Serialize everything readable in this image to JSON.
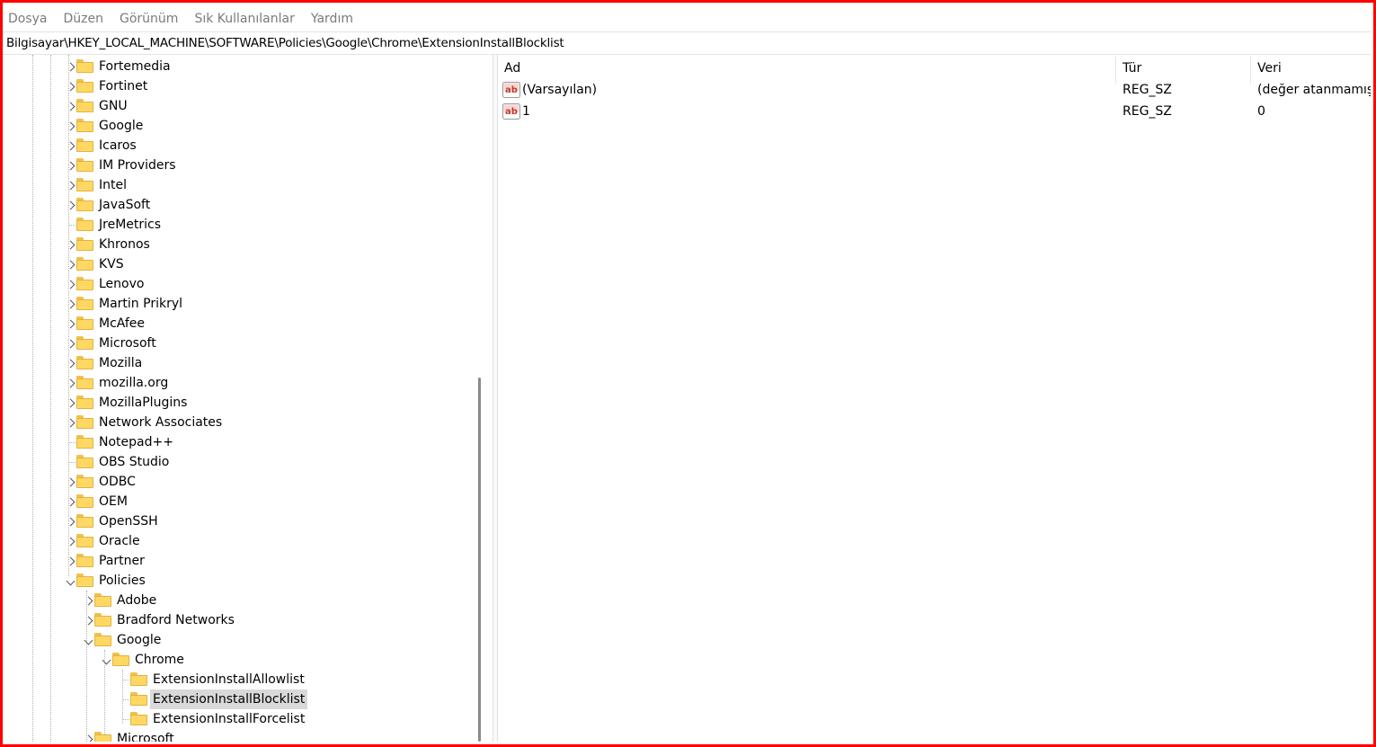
{
  "menu": [
    "Dosya",
    "Düzen",
    "Görünüm",
    "Sık Kullanılanlar",
    "Yardım"
  ],
  "address": "Bilgisayar\\HKEY_LOCAL_MACHINE\\SOFTWARE\\Policies\\Google\\Chrome\\ExtensionInstallBlocklist",
  "tree": [
    {
      "label": "Fortemedia",
      "level": 0,
      "exp": "collapsed"
    },
    {
      "label": "Fortinet",
      "level": 0,
      "exp": "collapsed"
    },
    {
      "label": "GNU",
      "level": 0,
      "exp": "collapsed"
    },
    {
      "label": "Google",
      "level": 0,
      "exp": "collapsed"
    },
    {
      "label": "Icaros",
      "level": 0,
      "exp": "collapsed"
    },
    {
      "label": "IM Providers",
      "level": 0,
      "exp": "collapsed"
    },
    {
      "label": "Intel",
      "level": 0,
      "exp": "collapsed"
    },
    {
      "label": "JavaSoft",
      "level": 0,
      "exp": "collapsed"
    },
    {
      "label": "JreMetrics",
      "level": 0,
      "exp": "none"
    },
    {
      "label": "Khronos",
      "level": 0,
      "exp": "collapsed"
    },
    {
      "label": "KVS",
      "level": 0,
      "exp": "collapsed"
    },
    {
      "label": "Lenovo",
      "level": 0,
      "exp": "collapsed"
    },
    {
      "label": "Martin Prikryl",
      "level": 0,
      "exp": "collapsed"
    },
    {
      "label": "McAfee",
      "level": 0,
      "exp": "collapsed"
    },
    {
      "label": "Microsoft",
      "level": 0,
      "exp": "collapsed"
    },
    {
      "label": "Mozilla",
      "level": 0,
      "exp": "collapsed"
    },
    {
      "label": "mozilla.org",
      "level": 0,
      "exp": "collapsed"
    },
    {
      "label": "MozillaPlugins",
      "level": 0,
      "exp": "collapsed"
    },
    {
      "label": "Network Associates",
      "level": 0,
      "exp": "collapsed"
    },
    {
      "label": "Notepad++",
      "level": 0,
      "exp": "none"
    },
    {
      "label": "OBS Studio",
      "level": 0,
      "exp": "none"
    },
    {
      "label": "ODBC",
      "level": 0,
      "exp": "collapsed"
    },
    {
      "label": "OEM",
      "level": 0,
      "exp": "collapsed"
    },
    {
      "label": "OpenSSH",
      "level": 0,
      "exp": "collapsed"
    },
    {
      "label": "Oracle",
      "level": 0,
      "exp": "collapsed"
    },
    {
      "label": "Partner",
      "level": 0,
      "exp": "collapsed"
    },
    {
      "label": "Policies",
      "level": 0,
      "exp": "expanded"
    },
    {
      "label": "Adobe",
      "level": 1,
      "exp": "collapsed"
    },
    {
      "label": "Bradford Networks",
      "level": 1,
      "exp": "collapsed"
    },
    {
      "label": "Google",
      "level": 1,
      "exp": "expanded"
    },
    {
      "label": "Chrome",
      "level": 2,
      "exp": "expanded"
    },
    {
      "label": "ExtensionInstallAllowlist",
      "level": 3,
      "exp": "none"
    },
    {
      "label": "ExtensionInstallBlocklist",
      "level": 3,
      "exp": "none",
      "selected": true
    },
    {
      "label": "ExtensionInstallForcelist",
      "level": 3,
      "exp": "none"
    },
    {
      "label": "Microsoft",
      "level": 1,
      "exp": "collapsed"
    }
  ],
  "columns": {
    "name": "Ad",
    "type": "Tür",
    "data": "Veri"
  },
  "values": [
    {
      "name": "(Varsayılan)",
      "type": "REG_SZ",
      "data": "(değer atanmamış)"
    },
    {
      "name": "1",
      "type": "REG_SZ",
      "data": "0"
    }
  ],
  "colors": {
    "frame": "#ff0000",
    "folder": "#ffd864",
    "selection": "#d9d9d9",
    "icon_red": "#c0392b"
  }
}
